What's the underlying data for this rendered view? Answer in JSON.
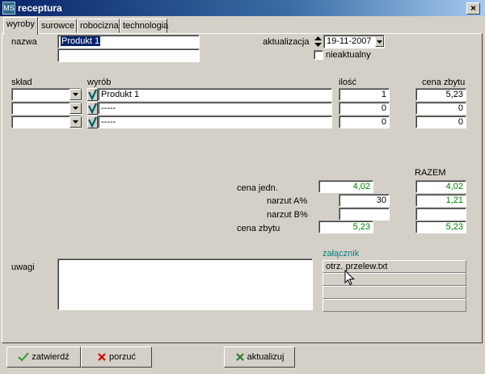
{
  "window": {
    "title": "receptura",
    "icon_text": "MS"
  },
  "tabs": [
    {
      "label": "wyroby"
    },
    {
      "label": "surowce"
    },
    {
      "label": "robocizna"
    },
    {
      "label": "technologia"
    }
  ],
  "form": {
    "nazwa_label": "nazwa",
    "nazwa_value": "Produkt 1",
    "nazwa_value2": "",
    "aktualizacja_label": "aktualizacja",
    "aktualizacja_value": "19-11-2007",
    "nieaktualny_label": "nieaktualny",
    "nieaktualny_checked": false
  },
  "grid": {
    "headers": {
      "sklad": "skład",
      "wyrob": "wyrób",
      "ilosc": "ilość",
      "cena": "cena zbytu"
    },
    "rows": [
      {
        "sklad": "",
        "wyrob": "Produkt 1",
        "ilosc": "1",
        "cena": "5,23"
      },
      {
        "sklad": "",
        "wyrob": "-----",
        "ilosc": "0",
        "cena": "0"
      },
      {
        "sklad": "",
        "wyrob": "-----",
        "ilosc": "0",
        "cena": "0"
      }
    ]
  },
  "calc": {
    "razem_label": "RAZEM",
    "cena_jedn_label": "cena jedn.",
    "cena_jedn": "4,02",
    "razem_cena_jedn": "4,02",
    "narzut_a_label": "narzut A%",
    "narzut_a": "30",
    "razem_narzut_a": "1,21",
    "narzut_b_label": "narzut B%",
    "narzut_b": "",
    "razem_narzut_b": "",
    "cena_zbytu_label": "cena zbytu",
    "cena_zbytu": "5,23",
    "razem_cena_zbytu": "5,23"
  },
  "uwagi": {
    "label": "uwagi",
    "value": ""
  },
  "zalacznik": {
    "label": "załącznik",
    "items": [
      "otrz. przelew.txt",
      "",
      "",
      ""
    ]
  },
  "buttons": {
    "zatwierdz": "zatwierdź",
    "porzuc": "porzuć",
    "aktualizuj": "aktualizuj"
  },
  "colors": {
    "title_start": "#0a246a",
    "value_green": "#008000",
    "label_teal": "#008080",
    "face": "#d4d0c8"
  }
}
